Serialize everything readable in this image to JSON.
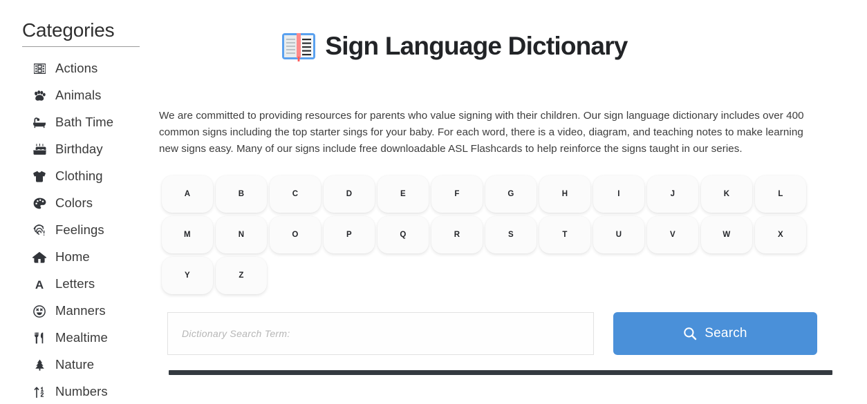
{
  "sidebar": {
    "title": "Categories",
    "items": [
      {
        "label": "Actions",
        "icon": "film-icon"
      },
      {
        "label": "Animals",
        "icon": "paw-icon"
      },
      {
        "label": "Bath Time",
        "icon": "bathtub-icon"
      },
      {
        "label": "Birthday",
        "icon": "birthday-cake-icon"
      },
      {
        "label": "Clothing",
        "icon": "tshirt-icon"
      },
      {
        "label": "Colors",
        "icon": "palette-icon"
      },
      {
        "label": "Feelings",
        "icon": "fingerprint-icon"
      },
      {
        "label": "Home",
        "icon": "home-icon"
      },
      {
        "label": "Letters",
        "icon": "letter-a-icon"
      },
      {
        "label": "Manners",
        "icon": "smiley-face-icon"
      },
      {
        "label": "Mealtime",
        "icon": "fork-knife-icon"
      },
      {
        "label": "Nature",
        "icon": "tree-icon"
      },
      {
        "label": "Numbers",
        "icon": "numbers-sort-icon"
      }
    ]
  },
  "header": {
    "title": "Sign Language Dictionary",
    "icon": "open-book-icon"
  },
  "main": {
    "intro": "We are committed to providing resources for parents who value signing with their children. Our sign language dictionary includes over 400 common signs including the top starter sings for your baby. For each word, there is a video, diagram, and teaching notes to make learning new signs easy. Many of our signs include free downloadable ASL Flashcards to help reinforce the signs taught in our series.",
    "letters": [
      "A",
      "B",
      "C",
      "D",
      "E",
      "F",
      "G",
      "H",
      "I",
      "J",
      "K",
      "L",
      "M",
      "N",
      "O",
      "P",
      "Q",
      "R",
      "S",
      "T",
      "U",
      "V",
      "W",
      "X",
      "Y",
      "Z"
    ]
  },
  "search": {
    "placeholder": "Dictionary Search Term:",
    "value": "",
    "button_label": "Search",
    "button_icon": "search-icon",
    "button_color": "#4a90d9"
  }
}
